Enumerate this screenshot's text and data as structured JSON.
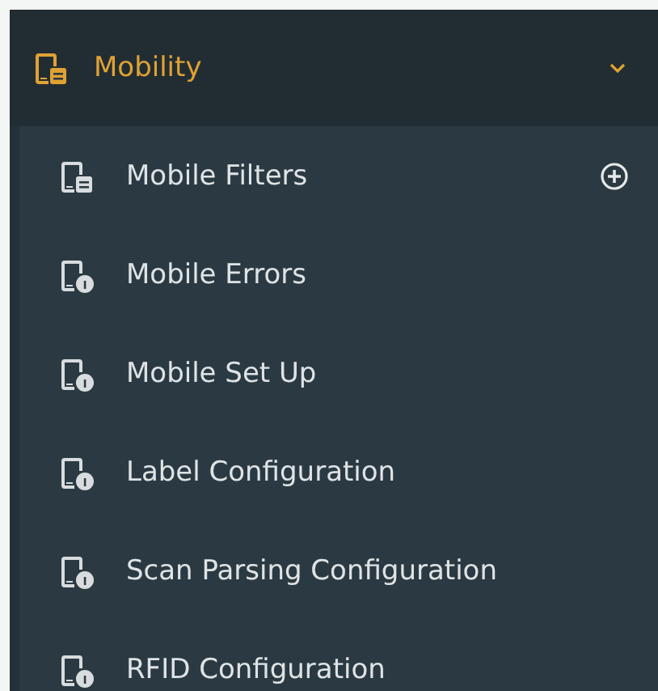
{
  "group": {
    "label": "Mobility",
    "expanded": true
  },
  "items": [
    {
      "label": "Mobile Filters",
      "kind": "filter",
      "add": true
    },
    {
      "label": "Mobile Errors",
      "kind": "info",
      "add": false
    },
    {
      "label": "Mobile Set Up",
      "kind": "info",
      "add": false
    },
    {
      "label": "Label Configuration",
      "kind": "info",
      "add": false
    },
    {
      "label": "Scan Parsing Configuration",
      "kind": "info",
      "add": false
    },
    {
      "label": "RFID Configuration",
      "kind": "info",
      "add": false
    }
  ]
}
